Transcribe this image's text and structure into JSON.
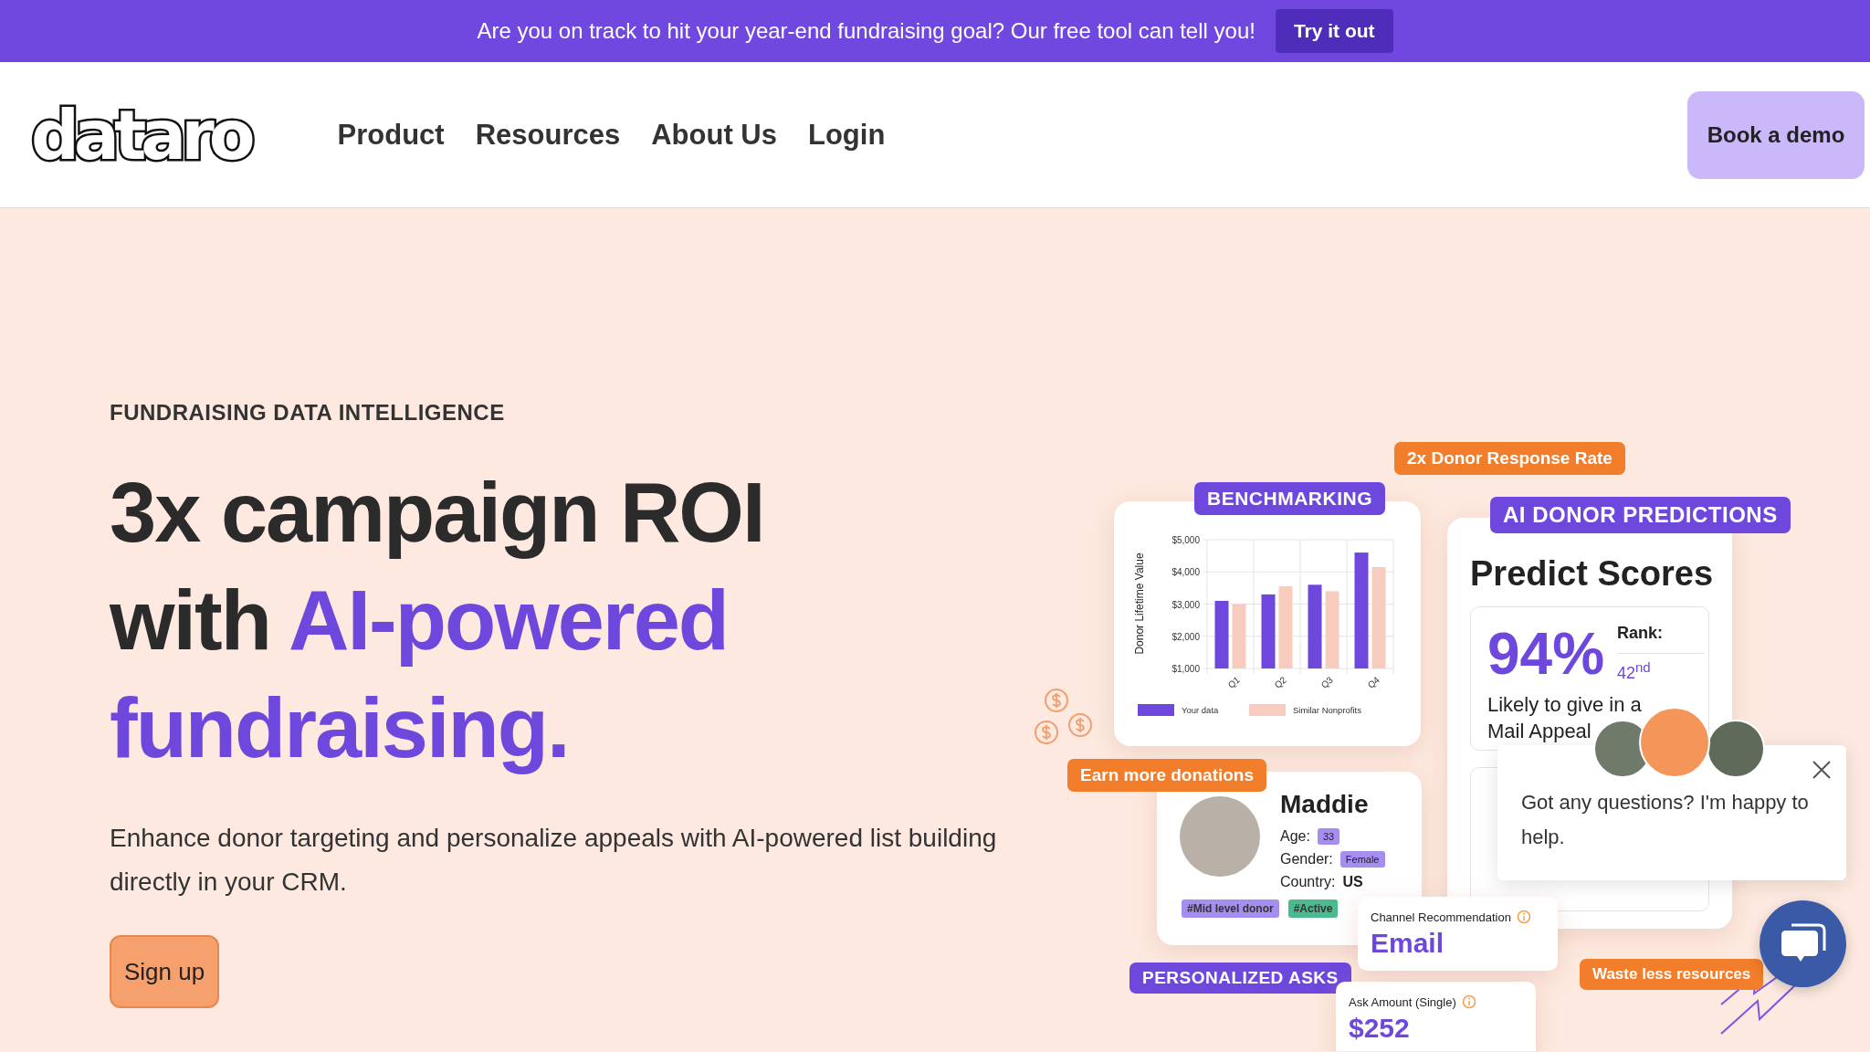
{
  "announcement": {
    "text": "Are you on track to hit your year-end fundraising goal? Our free tool can tell you!",
    "button": "Try it out"
  },
  "header": {
    "logo": "dataro",
    "nav": [
      {
        "label": "Product"
      },
      {
        "label": "Resources"
      },
      {
        "label": "About Us"
      },
      {
        "label": "Login"
      }
    ],
    "cta": "Book a demo"
  },
  "hero": {
    "eyebrow": "FUNDRAISING DATA INTELLIGENCE",
    "headline_lines": [
      [
        {
          "text": "3x campaign ROI",
          "highlight": false
        }
      ],
      [
        {
          "text": "with ",
          "highlight": false
        },
        {
          "text": "AI-powered",
          "highlight": true
        }
      ],
      [
        {
          "text": "fundraising.",
          "highlight": true
        }
      ]
    ],
    "description": "Enhance donor targeting and personalize appeals with AI-powered list building directly in your CRM.",
    "button": "Sign up"
  },
  "illustration": {
    "response_badge": "2x Donor Response Rate",
    "benchmarking": {
      "badge": "BENCHMARKING",
      "chart_data": {
        "type": "bar",
        "ylabel": "Donor Lifetime Value",
        "categories": [
          "Q1",
          "Q2",
          "Q3",
          "Q4"
        ],
        "series": [
          {
            "name": "Your data",
            "color": "#6e48dd",
            "values": [
              3100,
              3300,
              3600,
              4600
            ]
          },
          {
            "name": "Similar Nonprofits",
            "color": "#f8cbbf",
            "values": [
              3000,
              3550,
              3400,
              4150
            ]
          }
        ],
        "grid": true,
        "legend": true,
        "ylim": [
          1000,
          5000
        ],
        "yticks": [
          {
            "value": 1000,
            "label": "$1,000"
          },
          {
            "value": 2000,
            "label": "$2,000"
          },
          {
            "value": 3000,
            "label": "$3,000"
          },
          {
            "value": 4000,
            "label": "$4,000"
          },
          {
            "value": 5000,
            "label": "$5,000"
          }
        ]
      }
    },
    "predictions": {
      "badge": "AI DONOR PREDICTIONS",
      "title": "Predict Scores",
      "score": "94%",
      "rank_label": "Rank:",
      "rank": "42$^{nd}$",
      "description": "Likely to give in a Mail Appeal"
    },
    "earn_badge": "Earn more donations",
    "donor": {
      "name": "Maddie",
      "fields": [
        {
          "label": "Age:",
          "value": "33",
          "kind": "chip"
        },
        {
          "label": "Gender:",
          "value": "Female",
          "kind": "chip"
        },
        {
          "label": "Country:",
          "value": "US",
          "kind": "plain"
        }
      ],
      "tags": [
        {
          "text": "#Mid level donor",
          "color": "#a58ef0"
        },
        {
          "text": "#Active",
          "color": "#4cba8f"
        }
      ]
    },
    "channel": {
      "label": "Channel Recommendation",
      "value": "Email"
    },
    "asks_badge": "PERSONALIZED ASKS",
    "ask": {
      "label": "Ask Amount (Single)",
      "value": "$252"
    },
    "waste_badge": "Waste less resources"
  },
  "chat": {
    "message": "Got any questions? I'm happy to help."
  }
}
